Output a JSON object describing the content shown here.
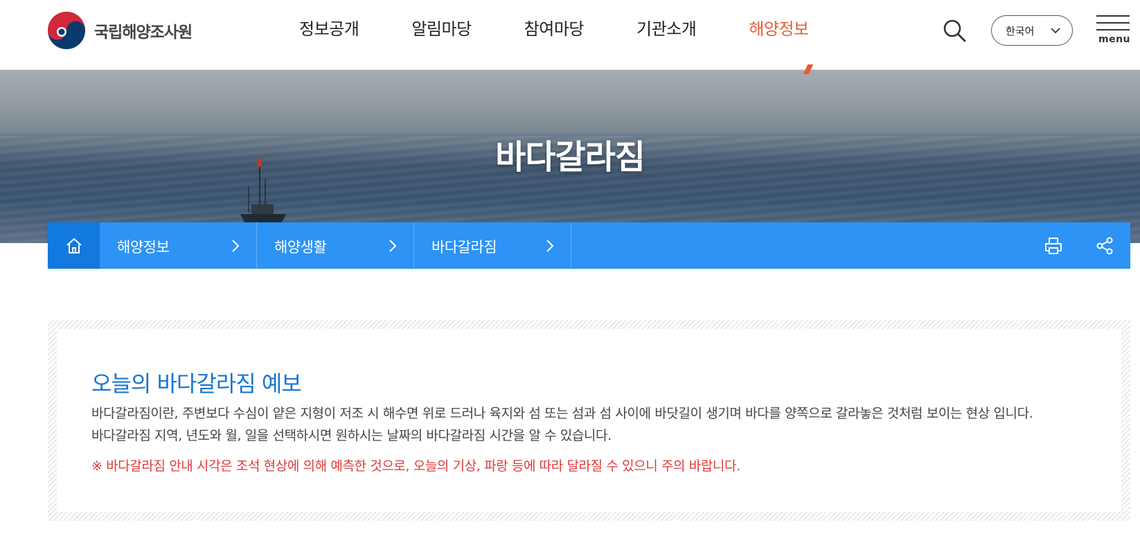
{
  "header": {
    "logo_text": "국립해양조사원",
    "nav": [
      {
        "label": "정보공개",
        "active": false
      },
      {
        "label": "알림마당",
        "active": false
      },
      {
        "label": "참여마당",
        "active": false
      },
      {
        "label": "기관소개",
        "active": false
      },
      {
        "label": "해양정보",
        "active": true
      }
    ],
    "language": "한국어",
    "menu_label": "menu",
    "icons": {
      "search": "search-icon",
      "menu": "hamburger-icon",
      "language": "chevron-down-icon"
    }
  },
  "hero": {
    "title": "바다갈라짐"
  },
  "breadcrumb": {
    "home_icon": "home-icon",
    "items": [
      {
        "label": "해양정보"
      },
      {
        "label": "해양생활"
      },
      {
        "label": "바다갈라짐"
      }
    ],
    "tools": [
      "print-icon",
      "share-icon"
    ]
  },
  "forecast": {
    "title": "오늘의 바다갈라짐 예보",
    "description_line1": "바다갈라짐이란, 주변보다 수심이 얕은 지형이 저조 시 해수면 위로 드러나 육지와 섬 또는 섬과 섬 사이에 바닷길이 생기며 바다를 양쪽으로 갈라놓은 것처럼 보이는 현상 입니다.",
    "description_line2": "바다갈라짐 지역, 년도와 월, 일을 선택하시면 원하시는 날짜의 바다갈라짐 시간을 알 수 있습니다.",
    "warning": "※ 바다갈라짐 안내 시각은 조석 현상에 의해 예측한 것으로, 오늘의 기상, 파랑 등에 따라 달라질 수 있으니 주의 바랍니다."
  },
  "colors": {
    "accent": "#e85b3a",
    "breadcrumb_bg": "#2d93f5",
    "breadcrumb_home_bg": "#1279df",
    "title_blue": "#1976d2",
    "warning_red": "#e03a3a"
  }
}
